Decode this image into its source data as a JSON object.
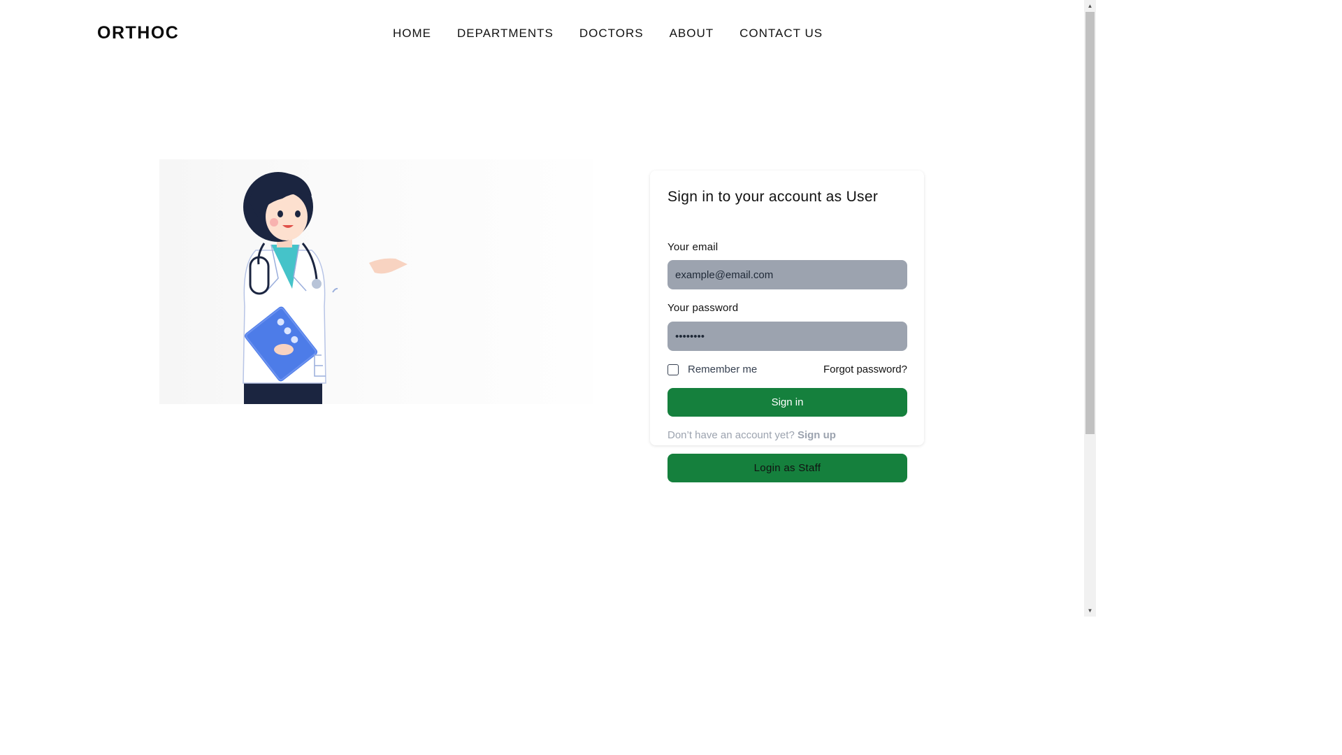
{
  "header": {
    "logo": "ORTHOC",
    "nav": [
      "HOME",
      "DEPARTMENTS",
      "DOCTORS",
      "ABOUT",
      "CONTACT US"
    ]
  },
  "login": {
    "title": "Sign in to your account as User",
    "email_label": "Your email",
    "email_placeholder": "example@email.com",
    "password_label": "Your password",
    "password_value": "••••••••",
    "remember_label": "Remember me",
    "forgot_label": "Forgot password?",
    "signin_label": "Sign in",
    "no_account_text": "Don’t have an account yet?",
    "signup_label": "Sign up",
    "staff_label": "Login as Staff"
  },
  "colors": {
    "accent_green": "#15803d",
    "input_bg": "#9ca3af"
  },
  "icons": {
    "checkbox": "empty-checkbox",
    "illustration": "doctor-illustration"
  }
}
